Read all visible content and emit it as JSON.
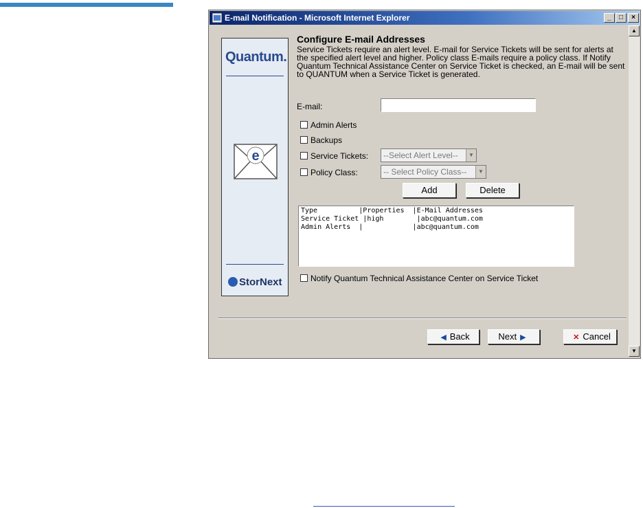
{
  "window": {
    "title": "E-mail Notification - Microsoft Internet Explorer",
    "controls": {
      "minimize": "_",
      "maximize": "□",
      "close": "×"
    }
  },
  "sidebar": {
    "brand": "Quantum.",
    "product": "StorNext",
    "envelope_letter": "e"
  },
  "main": {
    "heading": "Configure E-mail Addresses",
    "description": "Service Tickets require an alert level. E-mail for Service Tickets will be sent for alerts at the specified alert level and higher. Policy class E-mails require a policy class. If Notify Quantum Technical Assistance Center on Service Ticket is checked, an E-mail will be sent to QUANTUM when a Service Ticket is generated.",
    "email_label": "E-mail:",
    "email_value": "",
    "admin_alerts_label": "Admin Alerts",
    "backups_label": "Backups",
    "service_tickets_label": "Service Tickets:",
    "alert_level_select": "--Select Alert Level--",
    "policy_class_label": "Policy Class:",
    "policy_class_select": "-- Select Policy Class--",
    "add_button": "Add",
    "delete_button": "Delete",
    "list_rows": [
      "Type          |Properties  |E-Mail Addresses",
      "Service Ticket |high        |abc@quantum.com",
      "Admin Alerts  |            |abc@quantum.com"
    ],
    "notify_label": "Notify Quantum Technical Assistance Center on Service Ticket"
  },
  "footer": {
    "back_label": "Back",
    "next_label": "Next",
    "cancel_label": "Cancel"
  }
}
